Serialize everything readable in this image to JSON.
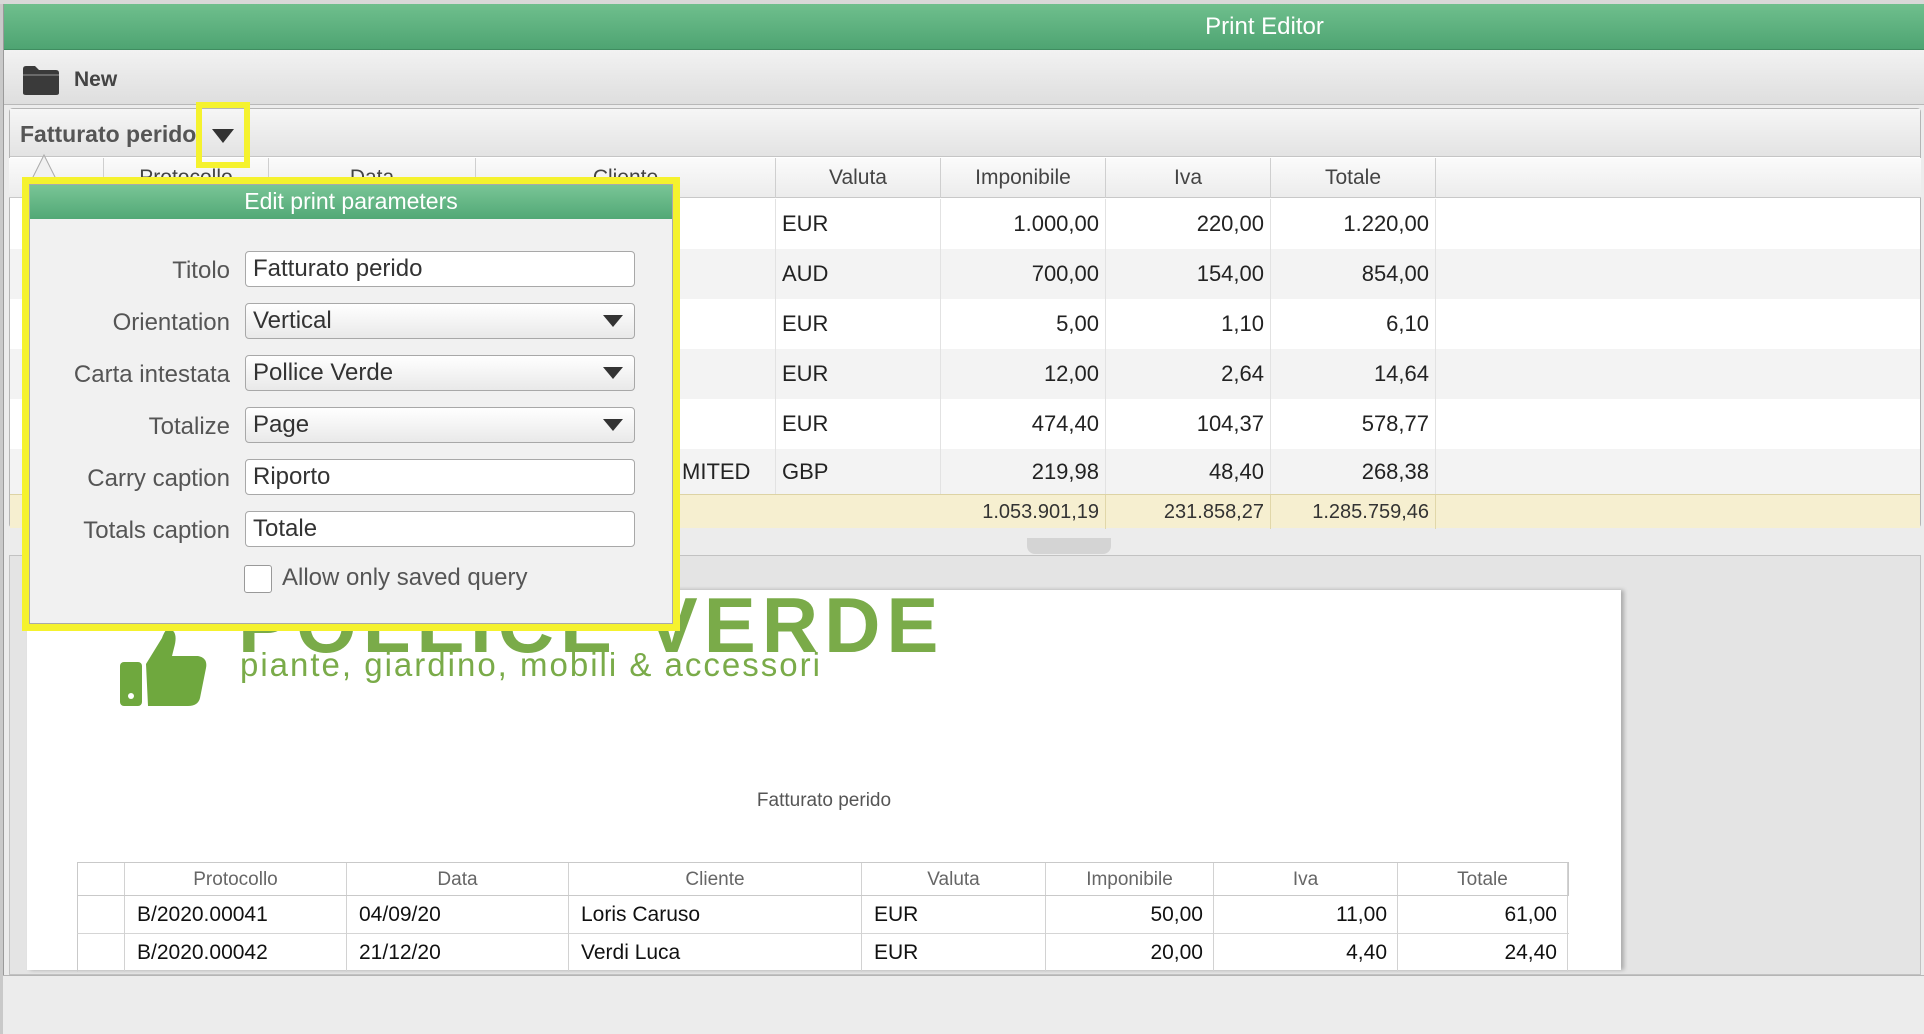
{
  "window": {
    "title": "Print Editor"
  },
  "toolbar": {
    "new_label": "New",
    "new_icon": "folder-icon"
  },
  "grid": {
    "title": "Fatturato perido",
    "columns": [
      "Protocollo",
      "Data",
      "Cliente",
      "Valuta",
      "Imponibile",
      "Iva",
      "Totale"
    ],
    "rows": [
      {
        "cliente": "",
        "valuta": "EUR",
        "imponibile": "1.000,00",
        "iva": "220,00",
        "totale": "1.220,00"
      },
      {
        "cliente": "",
        "valuta": "AUD",
        "imponibile": "700,00",
        "iva": "154,00",
        "totale": "854,00"
      },
      {
        "cliente": "",
        "valuta": "EUR",
        "imponibile": "5,00",
        "iva": "1,10",
        "totale": "6,10"
      },
      {
        "cliente": "",
        "valuta": "EUR",
        "imponibile": "12,00",
        "iva": "2,64",
        "totale": "14,64"
      },
      {
        "cliente": "",
        "valuta": "EUR",
        "imponibile": "474,40",
        "iva": "104,37",
        "totale": "578,77"
      },
      {
        "cliente": "MITED",
        "valuta": "GBP",
        "imponibile": "219,98",
        "iva": "48,40",
        "totale": "268,38"
      }
    ],
    "totals": {
      "imponibile": "1.053.901,19",
      "iva": "231.858,27",
      "totale": "1.285.759,46"
    }
  },
  "popover": {
    "title": "Edit print parameters",
    "fields": {
      "titolo": {
        "label": "Titolo",
        "value": "Fatturato perido"
      },
      "orientation": {
        "label": "Orientation",
        "value": "Vertical"
      },
      "carta": {
        "label": "Carta intestata",
        "value": "Pollice Verde"
      },
      "totalize": {
        "label": "Totalize",
        "value": "Page"
      },
      "carry": {
        "label": "Carry caption",
        "value": "Riporto"
      },
      "totals": {
        "label": "Totals caption",
        "value": "Totale"
      }
    },
    "allow_saved_label": "Allow only saved query",
    "allow_saved_checked": false
  },
  "preview": {
    "logo_text": "POLLICE VERDE",
    "logo_subtitle": "piante, giardino, mobili & accessori",
    "report_title": "Fatturato perido",
    "columns": [
      "Protocollo",
      "Data",
      "Cliente",
      "Valuta",
      "Imponibile",
      "Iva",
      "Totale"
    ],
    "rows": [
      {
        "protocollo": "B/2020.00041",
        "data": "04/09/20",
        "cliente": "Loris Caruso",
        "valuta": "EUR",
        "imponibile": "50,00",
        "iva": "11,00",
        "totale": "61,00"
      },
      {
        "protocollo": "B/2020.00042",
        "data": "21/12/20",
        "cliente": "Verdi Luca",
        "valuta": "EUR",
        "imponibile": "20,00",
        "iva": "4,40",
        "totale": "24,40"
      }
    ]
  },
  "colors": {
    "accent_green": "#52a876",
    "highlight_yellow": "#f5f22e",
    "logo_green": "#7aab49",
    "totals_bg": "#f6efd0"
  }
}
